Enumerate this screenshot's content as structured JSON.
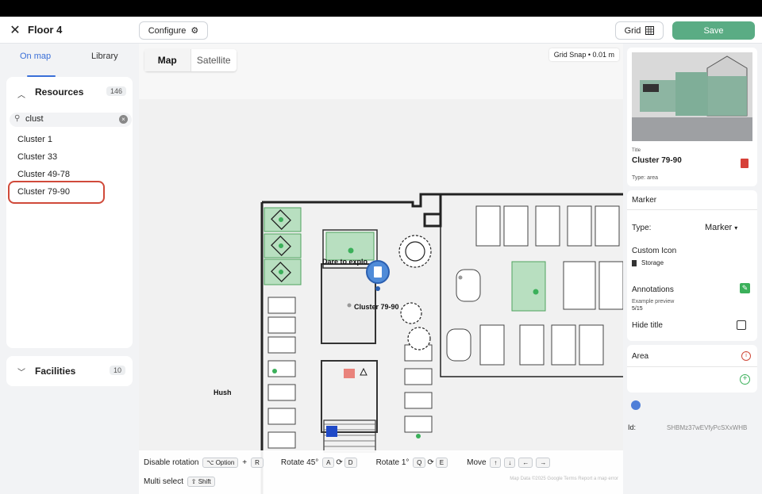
{
  "header": {
    "title": "Floor 4",
    "configure_label": "Configure",
    "grid_label": "Grid",
    "save_label": "Save"
  },
  "left_panel": {
    "tabs": [
      "On map",
      "Library"
    ],
    "active_tab": "On map",
    "resources": {
      "title": "Resources",
      "count": "146",
      "search_value": "clust",
      "items": [
        "Cluster 1",
        "Cluster 33",
        "Cluster 49-78",
        "Cluster 79-90"
      ],
      "selected": "Cluster 79-90"
    },
    "facilities": {
      "title": "Facilities",
      "count": "10"
    }
  },
  "map": {
    "toggle": [
      "Map",
      "Satellite"
    ],
    "active_toggle": "Map",
    "grid_snap": "Grid Snap • 0.01 m",
    "labels": {
      "dare": "Dare to explo",
      "cluster": "Cluster 79-90",
      "hush": "Hush"
    },
    "shortcuts": {
      "disable_rotation": "Disable rotation",
      "option_key": "⌥ Option",
      "plus": "+",
      "r_key": "R",
      "rotate45": "Rotate 45°",
      "a_key": "A",
      "d_key": "D",
      "rotate1": "Rotate 1°",
      "q_key": "Q",
      "e_key": "E",
      "move": "Move",
      "multi_select": "Multi select",
      "shift_key": "⇧ Shift"
    },
    "attribution": "Map Data ©2025 Google  Terms  Report a map error"
  },
  "right_panel": {
    "title_label": "Title",
    "title_value": "Cluster 79-90",
    "type_line": "Type: area",
    "marker_section": "Marker",
    "type_label": "Type:",
    "type_value": "Marker",
    "custom_icon_label": "Custom Icon",
    "custom_icon_value": "Storage",
    "annotations_label": "Annotations",
    "example_preview": "Example preview",
    "preview_count": "5/15",
    "hide_title_label": "Hide title",
    "area_label": "Area",
    "id_label": "Id:",
    "id_value": "SHBMz37wEVfyPcSXxWHB"
  },
  "colors": {
    "accent_blue": "#3a6fd8",
    "save_green": "#5aac84",
    "selected_zone_green": "#8fc99a",
    "highlight_red": "#d04a3a",
    "trash_red": "#d64038"
  }
}
